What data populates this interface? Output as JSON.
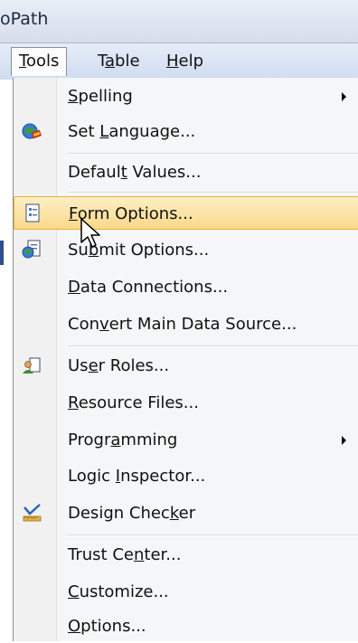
{
  "app": {
    "title": "oPath"
  },
  "menubar": {
    "items": [
      {
        "pre": "",
        "mn": "T",
        "post": "ools"
      },
      {
        "pre": "T",
        "mn": "a",
        "post": "ble"
      },
      {
        "pre": "",
        "mn": "H",
        "post": "elp"
      }
    ]
  },
  "tools_menu": {
    "items": [
      {
        "pre": "",
        "mn": "S",
        "post": "pelling",
        "icon": "",
        "has_submenu": true
      },
      {
        "pre": "Set ",
        "mn": "L",
        "post": "anguage...",
        "icon": "set-language-icon",
        "has_submenu": false
      },
      {
        "pre": "Defaul",
        "mn": "t",
        "post": " Values...",
        "icon": "",
        "has_submenu": false
      },
      {
        "pre": "",
        "mn": "F",
        "post": "orm Options...",
        "icon": "form-options-icon",
        "has_submenu": false,
        "highlighted": true
      },
      {
        "pre": "Su",
        "mn": "b",
        "post": "mit Options...",
        "icon": "submit-options-icon",
        "has_submenu": false
      },
      {
        "pre": "",
        "mn": "D",
        "post": "ata Connections...",
        "icon": "",
        "has_submenu": false
      },
      {
        "pre": "Con",
        "mn": "v",
        "post": "ert Main Data Source...",
        "icon": "",
        "has_submenu": false
      },
      {
        "pre": "Us",
        "mn": "e",
        "post": "r Roles...",
        "icon": "user-roles-icon",
        "has_submenu": false
      },
      {
        "pre": "",
        "mn": "R",
        "post": "esource Files...",
        "icon": "",
        "has_submenu": false
      },
      {
        "pre": "Progr",
        "mn": "a",
        "post": "mming",
        "icon": "",
        "has_submenu": true
      },
      {
        "pre": "Logic ",
        "mn": "I",
        "post": "nspector...",
        "icon": "",
        "has_submenu": false
      },
      {
        "pre": "Design Chec",
        "mn": "k",
        "post": "er",
        "icon": "design-checker-icon",
        "has_submenu": false
      },
      {
        "pre": "Trust Ce",
        "mn": "n",
        "post": "ter...",
        "icon": "",
        "has_submenu": false
      },
      {
        "pre": "",
        "mn": "C",
        "post": "ustomize...",
        "icon": "",
        "has_submenu": false
      },
      {
        "pre": "",
        "mn": "O",
        "post": "ptions...",
        "icon": "",
        "has_submenu": false
      }
    ]
  },
  "colors": {
    "highlight_top": "#fdefc4",
    "highlight_bottom": "#fcd88a",
    "highlight_border": "#e3b23f",
    "menubar": "#d6e1f2"
  }
}
